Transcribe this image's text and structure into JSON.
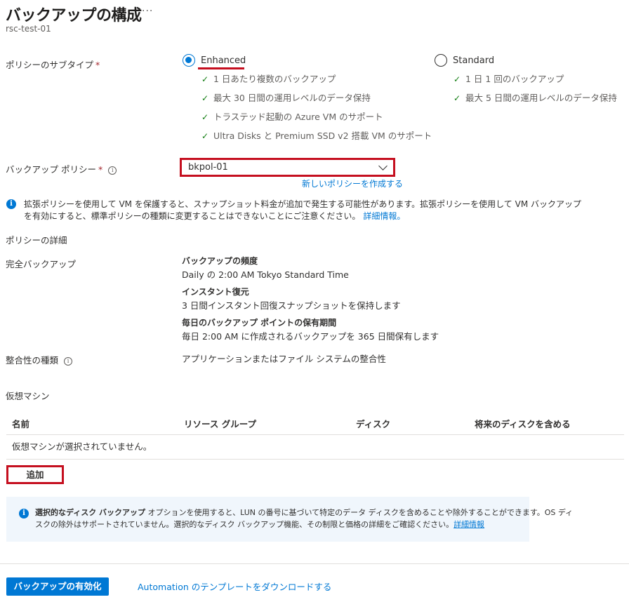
{
  "header": {
    "title": "バックアップの構成",
    "more": "···",
    "subtitle": "rsc-test-01"
  },
  "policy_subtype": {
    "label": "ポリシーのサブタイプ",
    "required_mark": "*",
    "options": [
      {
        "label": "Enhanced",
        "selected": true,
        "features": [
          "1 日あたり複数のバックアップ",
          "最大 30 日間の運用レベルのデータ保持",
          "トラステッド起動の Azure VM のサポート",
          "Ultra Disks と Premium SSD v2 搭載 VM のサポート"
        ]
      },
      {
        "label": "Standard",
        "selected": false,
        "features": [
          "1 日 1 回のバックアップ",
          "最大 5 日間の運用レベルのデータ保持"
        ]
      }
    ]
  },
  "backup_policy": {
    "label": "バックアップ ポリシー",
    "required_mark": "*",
    "value": "bkpol-01",
    "create_link": "新しいポリシーを作成する"
  },
  "enhanced_notice": {
    "text_line1": "拡張ポリシーを使用して VM を保護すると、スナップショット料金が追加で発生する可能性があります。拡張ポリシーを使用して VM バックアップ",
    "text_line2": "を有効にすると、標準ポリシーの種類に変更することはできないことにご注意ください。",
    "link": "詳細情報。"
  },
  "policy_details": {
    "heading": "ポリシーの詳細",
    "full_backup_label": "完全バックアップ",
    "frequency_title": "バックアップの頻度",
    "frequency_value": "Daily の 2:00 AM Tokyo Standard Time",
    "instant_title": "インスタント復元",
    "instant_value": "3 日間インスタント回復スナップショットを保持します",
    "retention_title": "毎日のバックアップ ポイントの保有期間",
    "retention_value": "毎日 2:00 AM に作成されるバックアップを 365 日間保有します",
    "consistency_label": "整合性の種類",
    "consistency_value": "アプリケーションまたはファイル システムの整合性"
  },
  "vm_section": {
    "heading": "仮想マシン",
    "columns": [
      "名前",
      "リソース グループ",
      "ディスク",
      "将来のディスクを含める"
    ],
    "empty_text": "仮想マシンが選択されていません。",
    "add_label": "追加"
  },
  "disk_notice": {
    "bold_text": "選択的なディスク バックアップ",
    "text_line1": " オプションを使用すると、LUN の番号に基づいて特定のデータ ディスクを含めることや除外することができます。OS ディ",
    "text_line2": "スクの除外はサポートされていません。選択的なディスク バックアップ機能、その制限と価格の詳細をご確認ください。",
    "link": "詳細情報"
  },
  "footer": {
    "enable_button": "バックアップの有効化",
    "template_link": "Automation のテンプレートをダウンロードする"
  },
  "colors": {
    "accent": "#0078d4",
    "highlight_red": "#c50f1f",
    "check_green": "#107c10",
    "info_bg": "#f0f6fc"
  }
}
